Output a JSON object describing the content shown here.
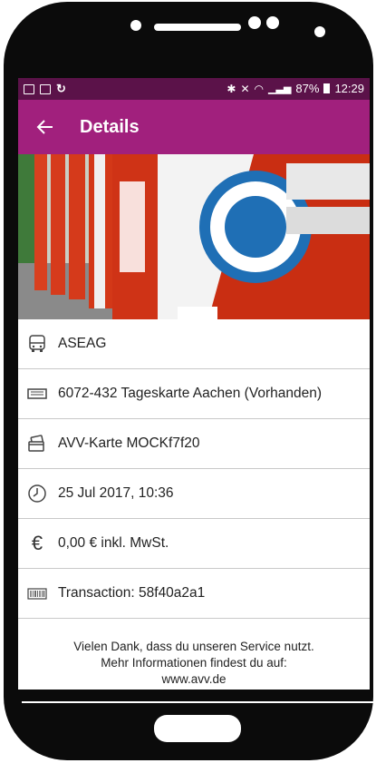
{
  "status_bar": {
    "battery": "87%",
    "time": "12:29"
  },
  "app_bar": {
    "title": "Details"
  },
  "details": [
    {
      "icon": "bus-icon",
      "text": "ASEAG"
    },
    {
      "icon": "ticket-icon",
      "text": "6072-432 Tageskarte Aachen (Vorhanden)"
    },
    {
      "icon": "card-icon",
      "text": "AVV-Karte MOCKf7f20"
    },
    {
      "icon": "clock-icon",
      "text": "25 Jul 2017, 10:36"
    },
    {
      "icon": "euro-icon",
      "text": "0,00 € inkl. MwSt."
    },
    {
      "icon": "barcode-icon",
      "text": "Transaction: 58f40a2a1"
    }
  ],
  "footer": {
    "line1": "Vielen Dank, dass du unseren Service nutzt.",
    "line2": "Mehr Informationen findest du auf:",
    "line3": "www.avv.de"
  },
  "colors": {
    "status_bar": "#5b1249",
    "app_bar": "#a1207d"
  }
}
